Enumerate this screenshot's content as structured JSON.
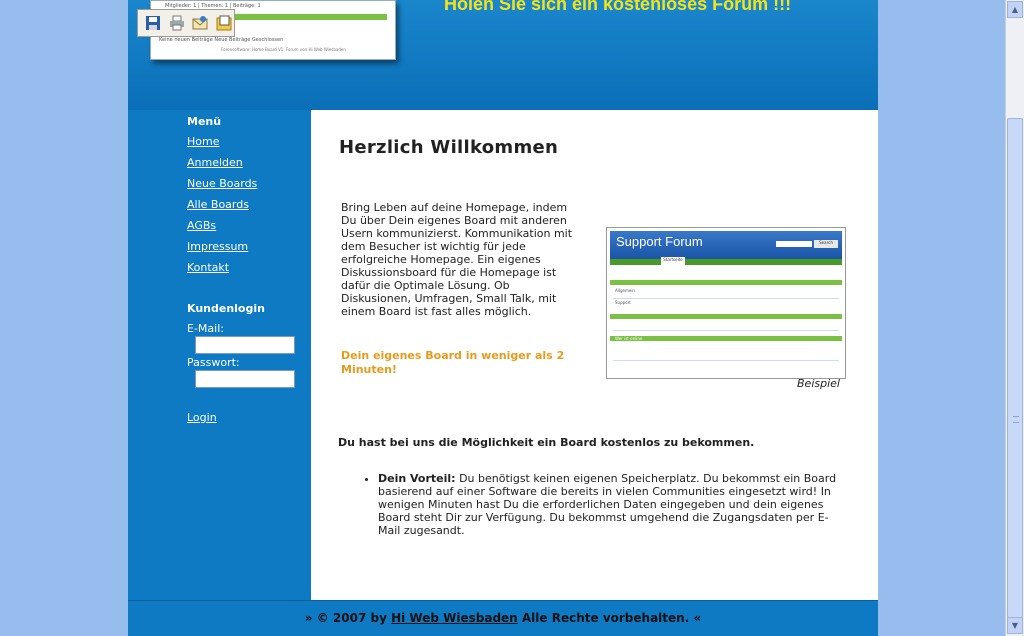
{
  "header": {
    "tagline": "Holen Sie sich ein kostenloses Forum !!!",
    "screenshot": {
      "line1": "Mitglieder: 1 | Themen: 1 | Beiträge: 1",
      "line2": "Keine neuen Beiträge",
      "line3": "Neue Beiträge",
      "line4": "Geschlossen",
      "footer": "Forensoftware: Home Board V1.  Forum von Hi Web Wiesbaden"
    }
  },
  "toolbar": {
    "icons": [
      "save-icon",
      "print-icon",
      "email-icon",
      "export-icon"
    ]
  },
  "sidebar": {
    "menu_heading": "Menü",
    "menu_items": [
      {
        "label": "Home"
      },
      {
        "label": "Anmelden"
      },
      {
        "label": "Neue Boards"
      },
      {
        "label": "Alle Boards"
      },
      {
        "label": "AGBs"
      },
      {
        "label": "Impressum"
      },
      {
        "label": "Kontakt"
      }
    ],
    "login_heading": "Kundenlogin",
    "email_label": "E-Mail:",
    "email_value": "",
    "password_label": "Passwort:",
    "password_value": "",
    "login_link": "Login"
  },
  "content": {
    "title": "Herzlich Willkommen",
    "intro": "Bring Leben auf deine Homepage, indem Du über Dein eigenes Board mit anderen Usern kommunizierst. Kommunikation mit dem Besucher ist wichtig für jede erfolgreiche Homepage. Ein eigenes Diskussionsboard für die Homepage ist dafür die Optimale Lösung. Ob Diskusionen, Umfragen, Small Talk, mit einem Board ist fast alles möglich.",
    "highlight": "Dein eigenes Board in weniger als 2 Minuten!",
    "preview": {
      "title": "Support Forum",
      "search_button": "Search",
      "nav_tab": "Startseite",
      "section1": "Allgemein",
      "section2": "Support",
      "section3": "Wer ist online"
    },
    "caption": "Beispiel",
    "subheading": "Du hast bei uns die Möglichkeit ein Board kostenlos zu bekommen.",
    "bullets": [
      {
        "bold": "Dein Vorteil:",
        "text": " Du benötigst keinen eigenen Speicherplatz. Du bekommst ein Board basierend auf einer Software die bereits in vielen Communities eingesetzt wird! In wenigen Minuten hast Du die erforderlichen Daten eingegeben und dein eigenes Board steht Dir zur Verfügung. Du bekommst umgehend die Zugangsdaten per E-Mail zugesandt."
      }
    ]
  },
  "footer": {
    "prefix": "» © 2007 by ",
    "link": "Hi Web Wiesbaden",
    "suffix": " Alle Rechte vorbehalten. «"
  },
  "colors": {
    "page_bg": "#97bdee",
    "brand_blue": "#0e7ac4",
    "tagline_yellow": "#f2e31c",
    "highlight_orange": "#e79b1c"
  }
}
